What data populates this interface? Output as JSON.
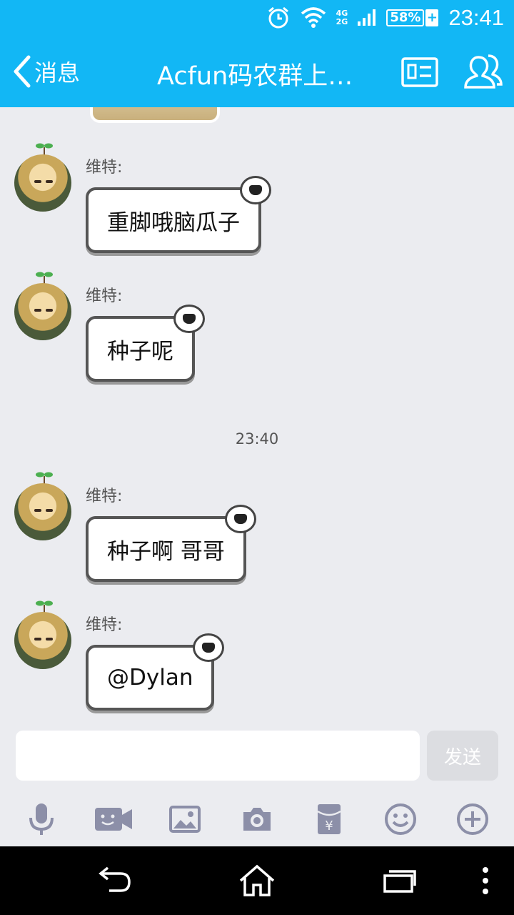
{
  "status_bar": {
    "time": "23:41",
    "battery_percent": "58%",
    "battery_charging": "+",
    "network_top": "4G",
    "network_bottom": "2G",
    "icons": [
      "alarm-icon",
      "wifi-icon",
      "signal-icon",
      "battery-icon"
    ]
  },
  "header": {
    "back_label": "消息",
    "title": "Acfun码农群上…",
    "icons": [
      "group-card-icon",
      "group-members-icon"
    ],
    "bg_color": "#12b7f5"
  },
  "messages": [
    {
      "sender": "维特:",
      "text": "重脚哦脑瓜子"
    },
    {
      "sender": "维特:",
      "text": "种子呢"
    },
    {
      "sender": "维特:",
      "text": "种子啊 哥哥"
    },
    {
      "sender": "维特:",
      "text": "@Dylan"
    }
  ],
  "timestamp": "23:40",
  "composer": {
    "input_value": "",
    "send_label": "发送"
  },
  "toolbar": {
    "items": [
      "microphone-icon",
      "video-call-icon",
      "image-icon",
      "camera-icon",
      "red-packet-icon",
      "emoji-icon",
      "plus-icon"
    ]
  },
  "nav_bar": {
    "items": [
      "back-nav-icon",
      "home-nav-icon",
      "recent-apps-icon",
      "menu-icon"
    ]
  }
}
